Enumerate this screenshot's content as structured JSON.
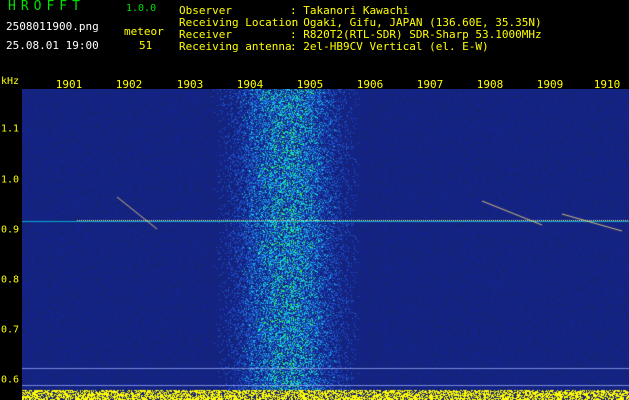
{
  "app": {
    "title": "HROFFT",
    "version": "1.0.0"
  },
  "capture": {
    "file_name": "2508011900.png",
    "datetime": "25.08.01 19:00",
    "meteor_label": "meteor",
    "meteor_count": "51"
  },
  "info": [
    {
      "label": "Observer",
      "value": ": Takanori Kawachi"
    },
    {
      "label": "Receiving Location",
      "value": ": Ogaki, Gifu, JAPAN (136.60E, 35.35N)"
    },
    {
      "label": "Receiver",
      "value": ": R820T2(RTL-SDR) SDR-Sharp 53.1000MHz"
    },
    {
      "label": "Receiving antenna",
      "value": ": 2el-HB9CV Vertical (el. E-W)"
    }
  ],
  "axes": {
    "freq_unit": "kHz",
    "time_ticks": [
      "1901",
      "1902",
      "1903",
      "1904",
      "1905",
      "1906",
      "1907",
      "1908",
      "1909",
      "1910"
    ],
    "freq_ticks": [
      "1.1",
      "1.0",
      "0.9",
      "0.8",
      "0.7",
      "0.6"
    ]
  },
  "colors": {
    "label": "#ffff00",
    "title": "#00e000",
    "background": "#000000",
    "noise": "#1a2a8a"
  }
}
